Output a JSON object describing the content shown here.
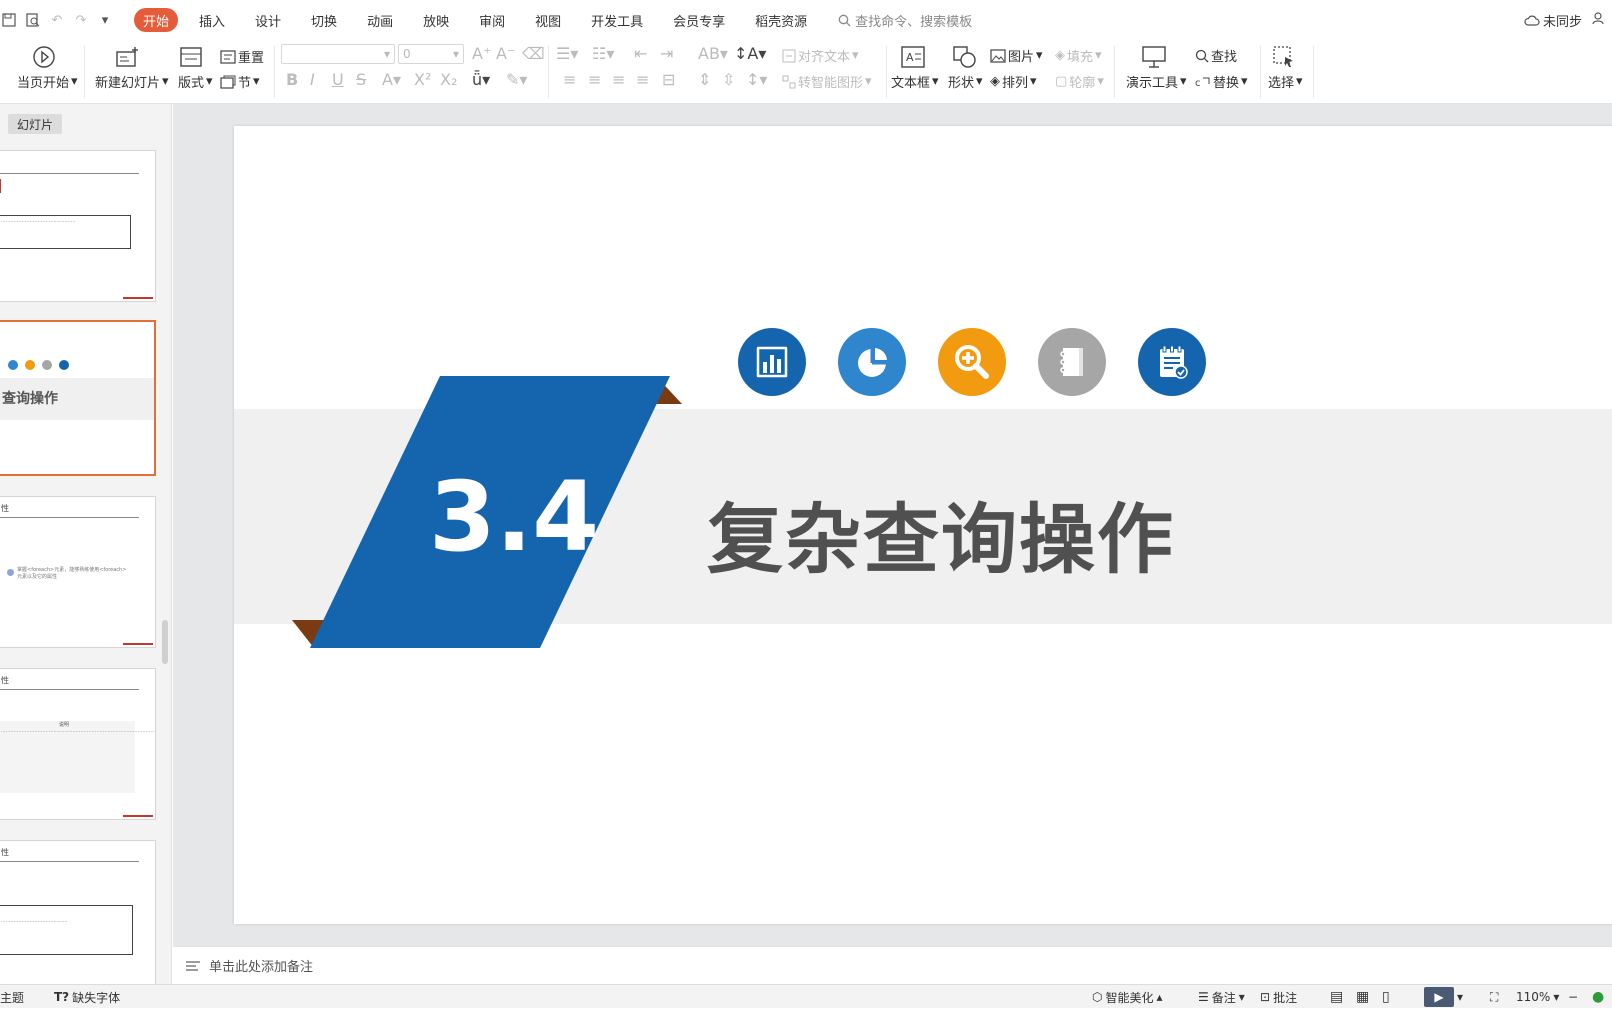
{
  "menu": {
    "tabs": [
      "开始",
      "插入",
      "设计",
      "切换",
      "动画",
      "放映",
      "审阅",
      "视图",
      "开发工具",
      "会员专享",
      "稻壳资源"
    ],
    "search_placeholder": "查找命令、搜索模板",
    "sync_label": "未同步"
  },
  "ribbon": {
    "from_current": "当页开始",
    "new_slide": "新建幻灯片",
    "layout": "版式",
    "reset": "重置",
    "section": "节",
    "font_name": "",
    "font_size": "0",
    "align_text": "对齐文本",
    "smart_art": "转智能图形",
    "text_box": "文本框",
    "shape": "形状",
    "picture": "图片",
    "arrange": "排列",
    "fill": "填充",
    "outline": "轮廓",
    "present_tools": "演示工具",
    "find": "查找",
    "replace": "替换",
    "select": "选择"
  },
  "left_panel": {
    "tab": "幻灯片",
    "thumb2_title": "查询操作",
    "thumb3_title": "性",
    "thumb4_title": "性",
    "thumb5_title": "性",
    "thumb3_text": "掌握<foreach>元素，能够熟练使用<foreach>元素以及它的属性",
    "thumb4_header": "说明"
  },
  "slide": {
    "number": "3.4",
    "title": "复杂查询操作",
    "colors": {
      "blue": "#1565ae",
      "light_blue": "#2f86cd",
      "orange": "#f29b11",
      "gray": "#a6a6a6",
      "brown": "#7a3a12"
    }
  },
  "icons": [
    "bar-chart-icon",
    "pie-chart-icon",
    "zoom-in-icon",
    "notebook-icon",
    "clipboard-check-icon"
  ],
  "notes_placeholder": "单击此处添加备注",
  "status": {
    "theme": "主题",
    "missing_font": "缺失字体",
    "smart_beautify": "智能美化",
    "notes": "备注",
    "comments": "批注",
    "zoom": "110%"
  }
}
